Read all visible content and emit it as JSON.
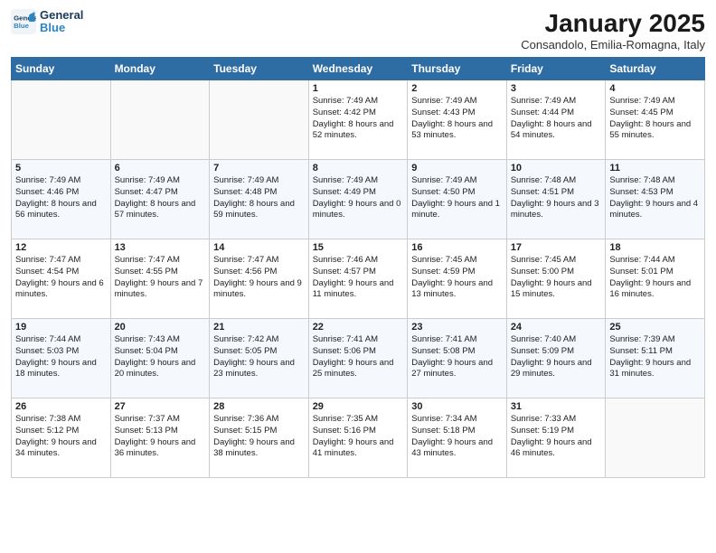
{
  "logo": {
    "line1": "General",
    "line2": "Blue"
  },
  "title": "January 2025",
  "subtitle": "Consandolo, Emilia-Romagna, Italy",
  "days_of_week": [
    "Sunday",
    "Monday",
    "Tuesday",
    "Wednesday",
    "Thursday",
    "Friday",
    "Saturday"
  ],
  "weeks": [
    [
      {
        "day": "",
        "text": ""
      },
      {
        "day": "",
        "text": ""
      },
      {
        "day": "",
        "text": ""
      },
      {
        "day": "1",
        "text": "Sunrise: 7:49 AM\nSunset: 4:42 PM\nDaylight: 8 hours\nand 52 minutes."
      },
      {
        "day": "2",
        "text": "Sunrise: 7:49 AM\nSunset: 4:43 PM\nDaylight: 8 hours\nand 53 minutes."
      },
      {
        "day": "3",
        "text": "Sunrise: 7:49 AM\nSunset: 4:44 PM\nDaylight: 8 hours\nand 54 minutes."
      },
      {
        "day": "4",
        "text": "Sunrise: 7:49 AM\nSunset: 4:45 PM\nDaylight: 8 hours\nand 55 minutes."
      }
    ],
    [
      {
        "day": "5",
        "text": "Sunrise: 7:49 AM\nSunset: 4:46 PM\nDaylight: 8 hours\nand 56 minutes."
      },
      {
        "day": "6",
        "text": "Sunrise: 7:49 AM\nSunset: 4:47 PM\nDaylight: 8 hours\nand 57 minutes."
      },
      {
        "day": "7",
        "text": "Sunrise: 7:49 AM\nSunset: 4:48 PM\nDaylight: 8 hours\nand 59 minutes."
      },
      {
        "day": "8",
        "text": "Sunrise: 7:49 AM\nSunset: 4:49 PM\nDaylight: 9 hours\nand 0 minutes."
      },
      {
        "day": "9",
        "text": "Sunrise: 7:49 AM\nSunset: 4:50 PM\nDaylight: 9 hours\nand 1 minute."
      },
      {
        "day": "10",
        "text": "Sunrise: 7:48 AM\nSunset: 4:51 PM\nDaylight: 9 hours\nand 3 minutes."
      },
      {
        "day": "11",
        "text": "Sunrise: 7:48 AM\nSunset: 4:53 PM\nDaylight: 9 hours\nand 4 minutes."
      }
    ],
    [
      {
        "day": "12",
        "text": "Sunrise: 7:47 AM\nSunset: 4:54 PM\nDaylight: 9 hours\nand 6 minutes."
      },
      {
        "day": "13",
        "text": "Sunrise: 7:47 AM\nSunset: 4:55 PM\nDaylight: 9 hours\nand 7 minutes."
      },
      {
        "day": "14",
        "text": "Sunrise: 7:47 AM\nSunset: 4:56 PM\nDaylight: 9 hours\nand 9 minutes."
      },
      {
        "day": "15",
        "text": "Sunrise: 7:46 AM\nSunset: 4:57 PM\nDaylight: 9 hours\nand 11 minutes."
      },
      {
        "day": "16",
        "text": "Sunrise: 7:45 AM\nSunset: 4:59 PM\nDaylight: 9 hours\nand 13 minutes."
      },
      {
        "day": "17",
        "text": "Sunrise: 7:45 AM\nSunset: 5:00 PM\nDaylight: 9 hours\nand 15 minutes."
      },
      {
        "day": "18",
        "text": "Sunrise: 7:44 AM\nSunset: 5:01 PM\nDaylight: 9 hours\nand 16 minutes."
      }
    ],
    [
      {
        "day": "19",
        "text": "Sunrise: 7:44 AM\nSunset: 5:03 PM\nDaylight: 9 hours\nand 18 minutes."
      },
      {
        "day": "20",
        "text": "Sunrise: 7:43 AM\nSunset: 5:04 PM\nDaylight: 9 hours\nand 20 minutes."
      },
      {
        "day": "21",
        "text": "Sunrise: 7:42 AM\nSunset: 5:05 PM\nDaylight: 9 hours\nand 23 minutes."
      },
      {
        "day": "22",
        "text": "Sunrise: 7:41 AM\nSunset: 5:06 PM\nDaylight: 9 hours\nand 25 minutes."
      },
      {
        "day": "23",
        "text": "Sunrise: 7:41 AM\nSunset: 5:08 PM\nDaylight: 9 hours\nand 27 minutes."
      },
      {
        "day": "24",
        "text": "Sunrise: 7:40 AM\nSunset: 5:09 PM\nDaylight: 9 hours\nand 29 minutes."
      },
      {
        "day": "25",
        "text": "Sunrise: 7:39 AM\nSunset: 5:11 PM\nDaylight: 9 hours\nand 31 minutes."
      }
    ],
    [
      {
        "day": "26",
        "text": "Sunrise: 7:38 AM\nSunset: 5:12 PM\nDaylight: 9 hours\nand 34 minutes."
      },
      {
        "day": "27",
        "text": "Sunrise: 7:37 AM\nSunset: 5:13 PM\nDaylight: 9 hours\nand 36 minutes."
      },
      {
        "day": "28",
        "text": "Sunrise: 7:36 AM\nSunset: 5:15 PM\nDaylight: 9 hours\nand 38 minutes."
      },
      {
        "day": "29",
        "text": "Sunrise: 7:35 AM\nSunset: 5:16 PM\nDaylight: 9 hours\nand 41 minutes."
      },
      {
        "day": "30",
        "text": "Sunrise: 7:34 AM\nSunset: 5:18 PM\nDaylight: 9 hours\nand 43 minutes."
      },
      {
        "day": "31",
        "text": "Sunrise: 7:33 AM\nSunset: 5:19 PM\nDaylight: 9 hours\nand 46 minutes."
      },
      {
        "day": "",
        "text": ""
      }
    ]
  ]
}
